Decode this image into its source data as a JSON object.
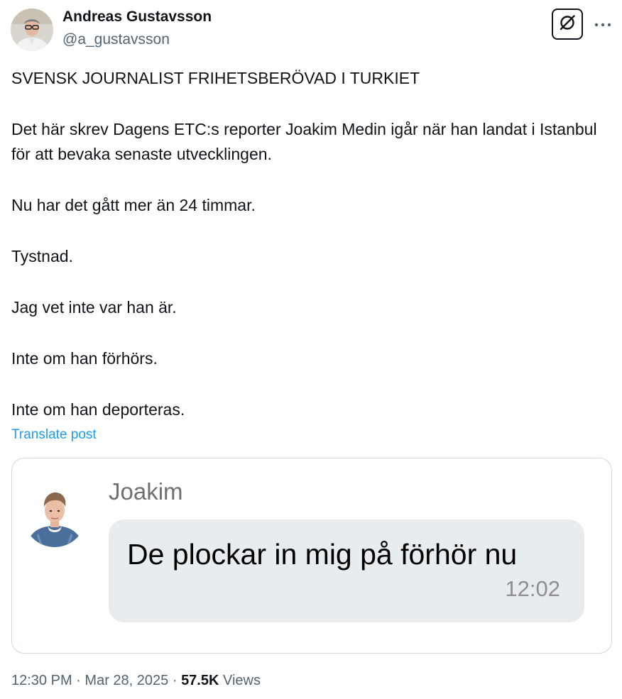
{
  "author": {
    "display_name": "Andreas Gustavsson",
    "handle": "@a_gustavsson"
  },
  "icons": {
    "grok": "grok-icon",
    "more": "more-horizontal-icon"
  },
  "post": {
    "paragraphs": [
      "SVENSK JOURNALIST FRIHETSBERÖVAD I TURKIET",
      "Det här skrev Dagens ETC:s reporter Joakim Medin igår när han landat i Istanbul för att bevaka senaste utvecklingen.",
      "Nu har det gått mer än 24 timmar.",
      "Tystnad.",
      "Jag vet inte var han är.",
      "Inte om han förhörs.",
      "Inte om han deporteras."
    ],
    "translate_label": "Translate post"
  },
  "media": {
    "contact_name": "Joakim",
    "message_text": "De plockar in mig på förhör nu",
    "message_time": "12:02"
  },
  "meta": {
    "time": "12:30 PM",
    "separator": "·",
    "date": "Mar 28, 2025",
    "views_count": "57.5K",
    "views_label": "Views"
  },
  "colors": {
    "text_primary": "#0f1419",
    "text_secondary": "#536471",
    "link": "#1d9bf0",
    "border": "#cfd9de",
    "bubble": "#e9ecef"
  }
}
